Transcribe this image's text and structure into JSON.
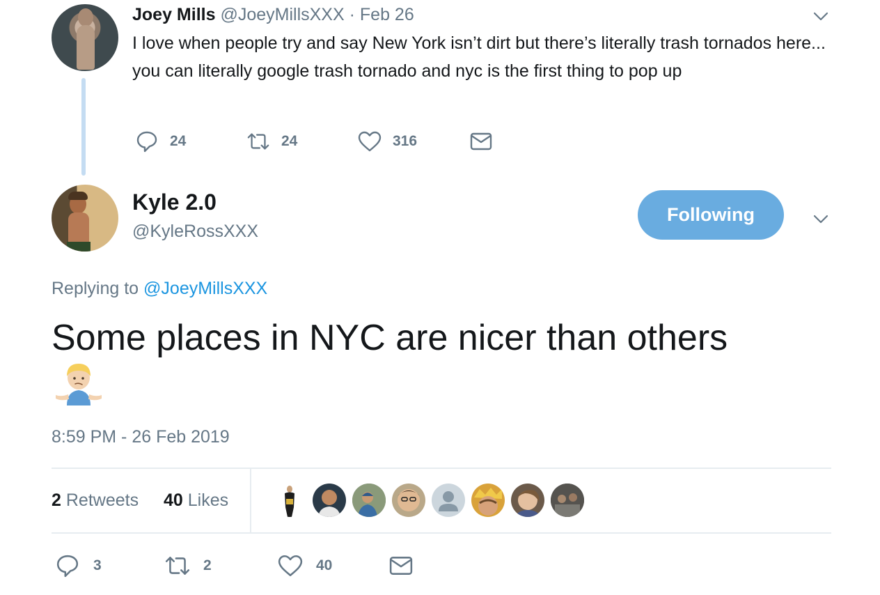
{
  "parent_tweet": {
    "name": "Joey Mills",
    "handle": "@JoeyMillsXXX",
    "separator": "·",
    "date": "Feb 26",
    "text": "I love when people try and say New York isn’t dirt but there’s literally trash tornados here... you can literally google trash tornado and nyc is the first thing to pop up",
    "replies": "24",
    "retweets": "24",
    "likes": "316"
  },
  "main_tweet": {
    "name": "Kyle 2.0",
    "handle": "@KyleRossXXX",
    "follow_label": "Following",
    "replying_prefix": "Replying to",
    "replying_handle": "@JoeyMillsXXX",
    "text": "Some places in NYC are nicer than others",
    "emoji": "person-shrugging-emoji",
    "timestamp": "8:59 PM - 26 Feb 2019",
    "retweet_count": "2",
    "retweet_label": "Retweets",
    "like_count": "40",
    "like_label": "Likes",
    "actions": {
      "replies": "3",
      "retweets": "2",
      "likes": "40"
    }
  },
  "colors": {
    "accent": "#1b95e0",
    "follow_button": "#69ace0",
    "secondary_text": "#657786",
    "thread_line": "#c4dcf2",
    "divider": "#e6ecf0"
  },
  "icons": [
    "reply-icon",
    "retweet-icon",
    "heart-icon",
    "envelope-icon",
    "chevron-down-icon"
  ]
}
